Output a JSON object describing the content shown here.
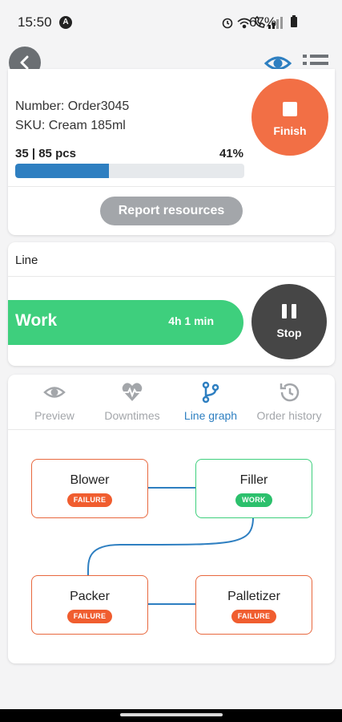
{
  "status_bar": {
    "time": "15:50",
    "notification_badge": "A",
    "battery_percent": "67%",
    "icons": [
      "alarm-icon",
      "wifi-icon",
      "wifi-calling-icon",
      "signal-icon",
      "battery-icon"
    ]
  },
  "header": {
    "back_icon": "back-arrow-icon",
    "view_icon": "eye-icon",
    "menu_icon": "list-icon"
  },
  "order": {
    "number": "Number: Order3045",
    "sku": "SKU: Cream 185ml",
    "progress_count": "35  |  85 pcs",
    "progress_percent": "41%",
    "progress_value": 0.41,
    "report_label": "Report resources",
    "finish_label": "Finish"
  },
  "line": {
    "title": "Line",
    "status_label": "Work",
    "duration": "4h 1 min",
    "stop_label": "Stop"
  },
  "tabs": [
    {
      "label": "Preview",
      "icon": "eye-icon",
      "active": false
    },
    {
      "label": "Downtimes",
      "icon": "heartbeat-icon",
      "active": false
    },
    {
      "label": "Line graph",
      "icon": "branch-icon",
      "active": true
    },
    {
      "label": "Order history",
      "icon": "history-icon",
      "active": false
    }
  ],
  "graph": {
    "nodes": [
      {
        "name": "Blower",
        "status": "FAILURE"
      },
      {
        "name": "Filler",
        "status": "WORK"
      },
      {
        "name": "Packer",
        "status": "FAILURE"
      },
      {
        "name": "Palletizer",
        "status": "FAILURE"
      }
    ]
  },
  "colors": {
    "accent_blue": "#2e7fc1",
    "work_green": "#3ecf7d",
    "failure_orange": "#f05d2f",
    "finish_orange": "#f26f45",
    "stop_dark": "#464646",
    "report_gray": "#a3a6aa"
  }
}
